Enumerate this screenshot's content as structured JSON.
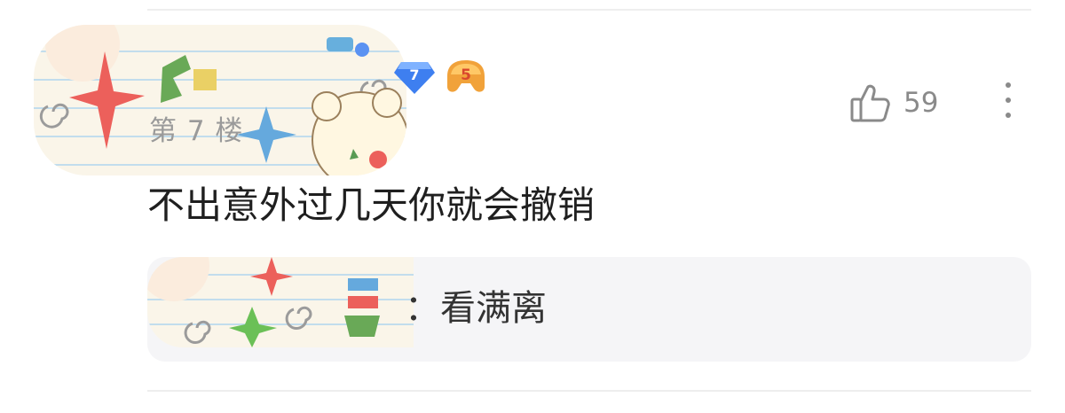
{
  "post": {
    "floor": "第 7 楼",
    "comment": "不出意外过几天你就会撤销",
    "likes": "59",
    "badges": {
      "level": "7",
      "fan_level": "5"
    }
  },
  "reply": {
    "text": "：看满离"
  },
  "icons": {
    "like": "thumbs-up-icon",
    "more": "vertical-ellipsis-icon",
    "level_badge": "diamond-level-badge-icon",
    "fan_badge": "fan-level-badge-icon"
  },
  "colors": {
    "level_badge": "#3e7ff0",
    "fan_badge": "#f1a23a",
    "secondary_text": "#9a9a9a",
    "reply_background": "#f5f5f7"
  }
}
